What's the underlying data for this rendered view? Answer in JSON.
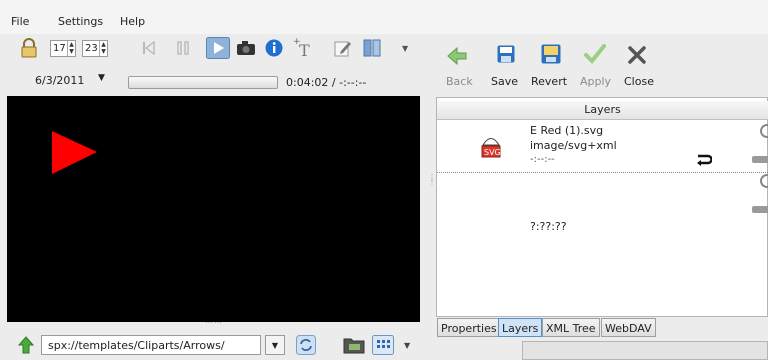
{
  "menu": {
    "file": "File",
    "settings": "Settings",
    "help": "Help"
  },
  "player": {
    "spin_a": "17",
    "spin_b": "23",
    "date": "6/3/2011",
    "time": "0:04:02 / -:--:--",
    "progress": 0
  },
  "right_toolbar": {
    "back": "Back",
    "save": "Save",
    "revert": "Revert",
    "apply": "Apply",
    "close": "Close"
  },
  "layers": {
    "header": "Layers",
    "item": {
      "name": "E Red (1).svg",
      "mime": "image/svg+xml",
      "duration": "-:--:--",
      "thumb_label": "SVG"
    },
    "second_duration": "?:??:??"
  },
  "tabs": [
    "Properties",
    "Layers",
    "XML Tree",
    "WebDAV"
  ],
  "active_tab": "Layers",
  "url": {
    "value": "spx://templates/Cliparts/Arrows/"
  },
  "colors": {
    "accent": "#3a7fd6",
    "play": "#ff0000",
    "video_bg": "#000000"
  }
}
